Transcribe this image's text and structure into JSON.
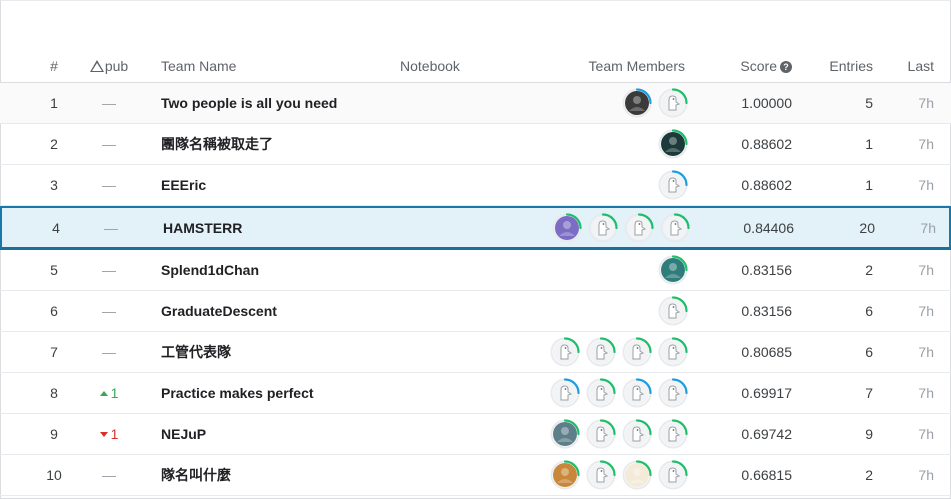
{
  "header": {
    "rank": "#",
    "delta_pub": "pub",
    "team_name": "Team Name",
    "notebook": "Notebook",
    "team_members": "Team Members",
    "score": "Score",
    "entries": "Entries",
    "last": "Last"
  },
  "colors": {
    "ring_green": "#20be6a",
    "ring_blue": "#1f9ce0",
    "highlight_border": "#1a78a8",
    "highlight_bg": "#e3f1f8"
  },
  "rows": [
    {
      "rank": "1",
      "pub": "—",
      "team": "Two people is all you need",
      "score": "1.00000",
      "entries": "5",
      "last": "7h",
      "members": [
        {
          "icon": "cat-photo-icon",
          "ring": "blue",
          "fill": "#3a3a3a"
        },
        {
          "icon": "default-goose-icon",
          "ring": "green"
        }
      ]
    },
    {
      "rank": "2",
      "pub": "—",
      "team": "團隊名稱被取走了",
      "score": "0.88602",
      "entries": "1",
      "last": "7h",
      "members": [
        {
          "icon": "dark-photo-icon",
          "ring": "green",
          "fill": "#1d3a3a"
        }
      ]
    },
    {
      "rank": "3",
      "pub": "—",
      "team": "EEEric",
      "score": "0.88602",
      "entries": "1",
      "last": "7h",
      "members": [
        {
          "icon": "default-goose-icon",
          "ring": "blue"
        }
      ]
    },
    {
      "rank": "4",
      "pub": "—",
      "team": "HAMSTERR",
      "score": "0.84406",
      "entries": "20",
      "last": "7h",
      "members": [
        {
          "icon": "purple-photo-icon",
          "ring": "green",
          "fill": "#7b6cc4"
        },
        {
          "icon": "default-goose-icon",
          "ring": "green"
        },
        {
          "icon": "default-goose-icon",
          "ring": "green"
        },
        {
          "icon": "default-goose-icon",
          "ring": "green"
        }
      ]
    },
    {
      "rank": "5",
      "pub": "—",
      "team": "Splend1dChan",
      "score": "0.83156",
      "entries": "2",
      "last": "7h",
      "members": [
        {
          "icon": "teal-photo-icon",
          "ring": "green",
          "fill": "#2f7d7a"
        }
      ]
    },
    {
      "rank": "6",
      "pub": "—",
      "team": "GraduateDescent",
      "score": "0.83156",
      "entries": "6",
      "last": "7h",
      "members": [
        {
          "icon": "default-goose-icon",
          "ring": "green"
        }
      ]
    },
    {
      "rank": "7",
      "pub": "—",
      "team": "工管代表隊",
      "score": "0.80685",
      "entries": "6",
      "last": "7h",
      "members": [
        {
          "icon": "default-goose-icon",
          "ring": "green"
        },
        {
          "icon": "default-goose-icon",
          "ring": "green"
        },
        {
          "icon": "default-goose-icon",
          "ring": "green"
        },
        {
          "icon": "default-goose-icon",
          "ring": "green"
        }
      ]
    },
    {
      "rank": "8",
      "pub": "1",
      "pub_dir": "up",
      "team": "Practice makes perfect",
      "score": "0.69917",
      "entries": "7",
      "last": "7h",
      "members": [
        {
          "icon": "default-goose-icon",
          "ring": "blue"
        },
        {
          "icon": "default-goose-icon",
          "ring": "green"
        },
        {
          "icon": "default-goose-icon",
          "ring": "blue"
        },
        {
          "icon": "default-goose-icon",
          "ring": "blue"
        }
      ]
    },
    {
      "rank": "9",
      "pub": "1",
      "pub_dir": "down",
      "team": "NEJuP",
      "score": "0.69742",
      "entries": "9",
      "last": "7h",
      "members": [
        {
          "icon": "painting-photo-icon",
          "ring": "green",
          "fill": "#5e7f8a"
        },
        {
          "icon": "default-goose-icon",
          "ring": "green"
        },
        {
          "icon": "default-goose-icon",
          "ring": "green"
        },
        {
          "icon": "default-goose-icon",
          "ring": "green"
        }
      ]
    },
    {
      "rank": "10",
      "pub": "—",
      "team": "隊名叫什麼",
      "score": "0.66815",
      "entries": "2",
      "last": "7h",
      "members": [
        {
          "icon": "orange-photo-icon",
          "ring": "green",
          "fill": "#c8873a"
        },
        {
          "icon": "default-goose-icon",
          "ring": "green"
        },
        {
          "icon": "drawing-photo-icon",
          "ring": "green",
          "fill": "#f3ead8"
        },
        {
          "icon": "default-goose-icon",
          "ring": "green"
        }
      ]
    }
  ]
}
